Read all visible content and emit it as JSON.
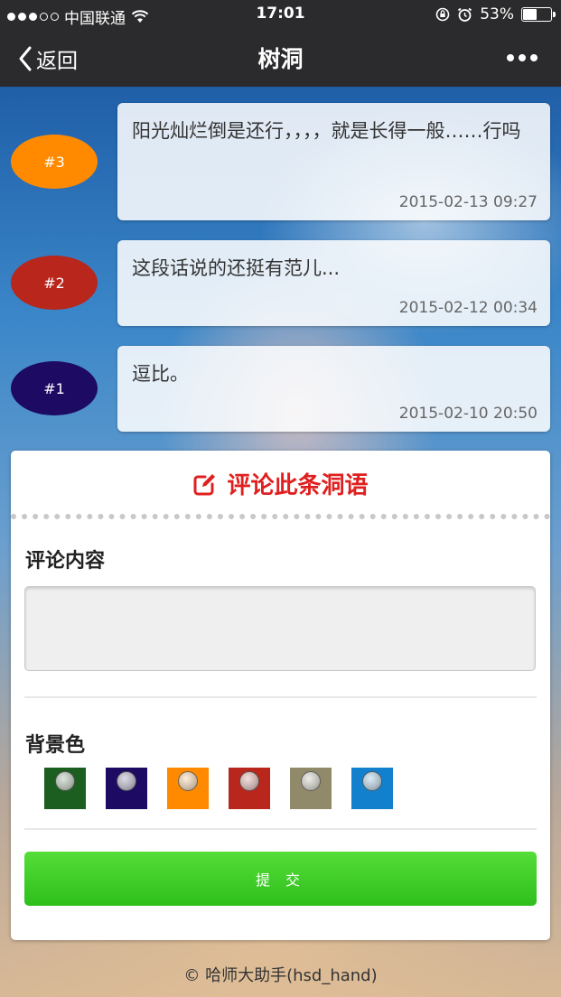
{
  "status_bar": {
    "carrier": "中国联通",
    "signal_bars": 3,
    "time": "17:01",
    "battery_percent": "53%",
    "battery_level": 0.53
  },
  "nav": {
    "back_label": "返回",
    "title": "树洞"
  },
  "messages": [
    {
      "badge": "#3",
      "color": "#ff8a00",
      "text": "阳光灿烂倒是还行，，，，就是长得一般……行吗",
      "time": "2015-02-13 09:27"
    },
    {
      "badge": "#2",
      "color": "#b8261c",
      "text": "这段话说的还挺有范儿...",
      "time": "2015-02-12 00:34"
    },
    {
      "badge": "#1",
      "color": "#1d0a63",
      "text": "逗比。",
      "time": "2015-02-10 20:50"
    }
  ],
  "comment_form": {
    "heading": "评论此条洞语",
    "content_label": "评论内容",
    "content_value": "",
    "bg_label": "背景色",
    "colors": [
      "#1b5e20",
      "#1d0a63",
      "#ff8a00",
      "#b8261c",
      "#918a6a",
      "#1280cc"
    ],
    "submit_label": "提 交"
  },
  "footer": "© 哈师大助手(hsd_hand)"
}
